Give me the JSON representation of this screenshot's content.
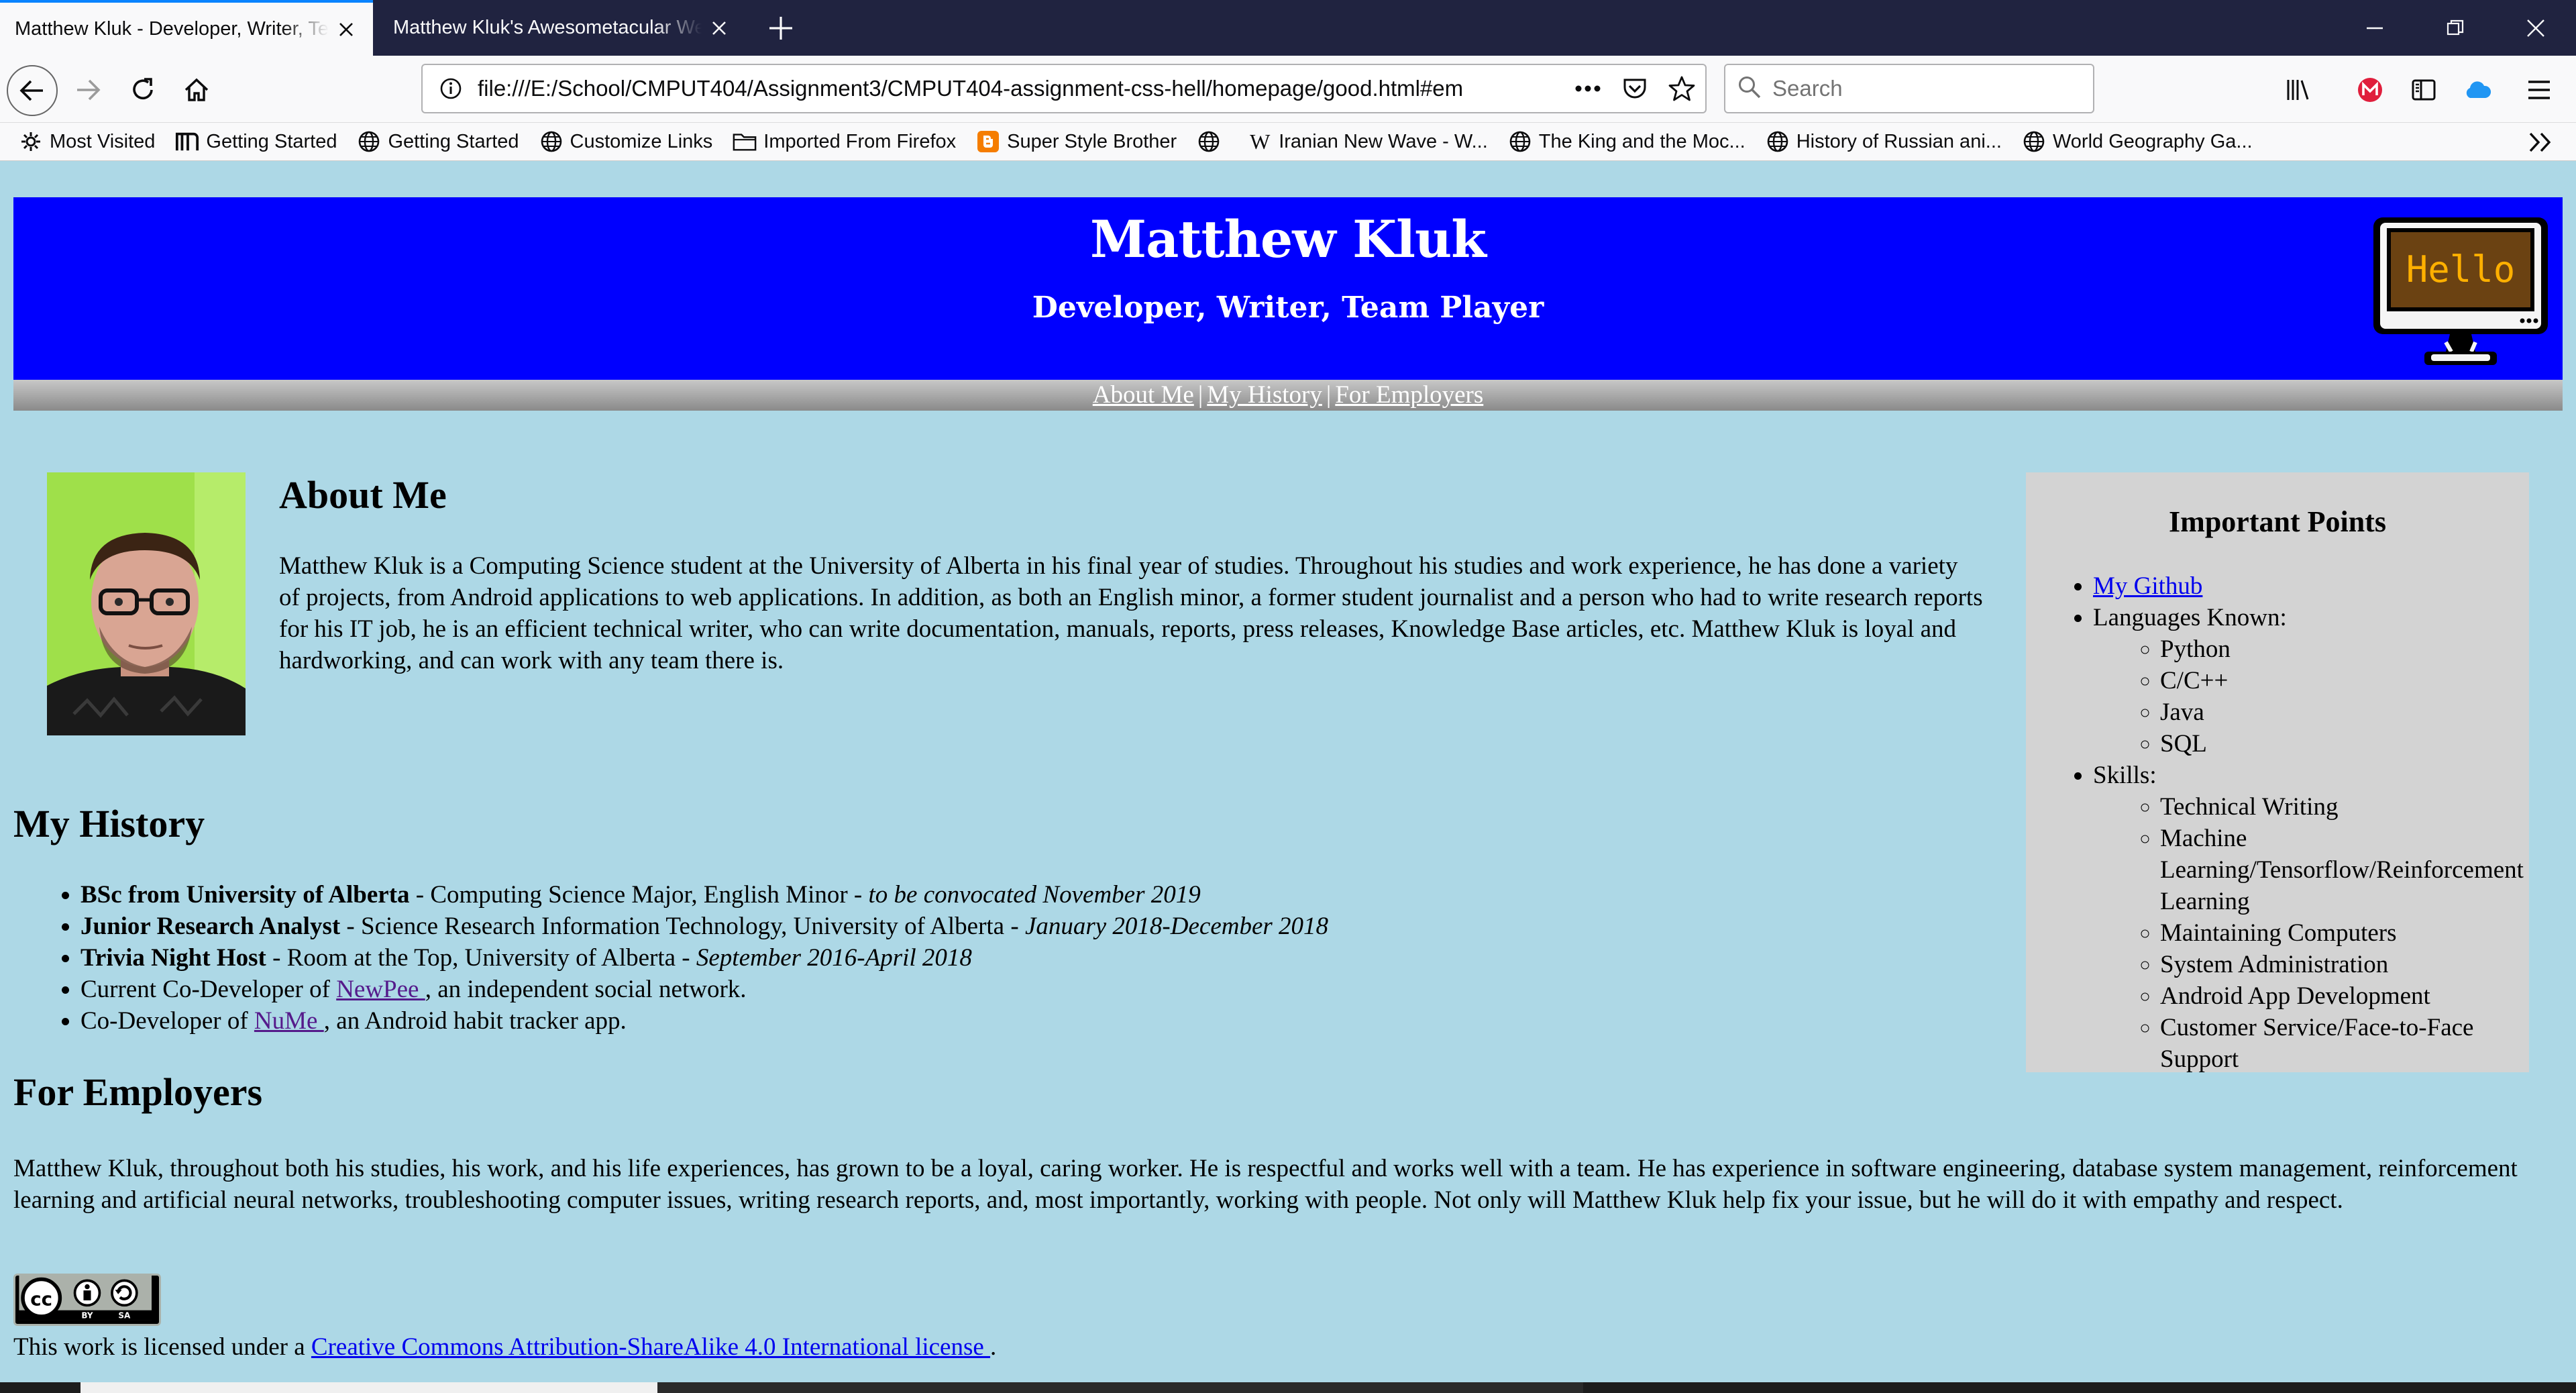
{
  "browser": {
    "tabs": [
      {
        "title": "Matthew Kluk - Developer, Writer, Team Player",
        "active": true
      },
      {
        "title": "Matthew Kluk's Awesometacular Website",
        "active": false
      }
    ],
    "url": "file:///E:/School/CMPUT404/Assignment3/CMPUT404-assignment-css-hell/homepage/good.html#em",
    "search_placeholder": "Search",
    "bookmarks": [
      {
        "label": "Most Visited",
        "icon": "gear-icon"
      },
      {
        "label": "Getting Started",
        "icon": "m-logo-icon"
      },
      {
        "label": "Getting Started",
        "icon": "globe-icon"
      },
      {
        "label": "Customize Links",
        "icon": "globe-icon"
      },
      {
        "label": "Imported From Firefox",
        "icon": "folder-icon"
      },
      {
        "label": "Super Style Brother",
        "icon": "blogger-icon"
      },
      {
        "label": "",
        "icon": "globe-icon"
      },
      {
        "label": "Iranian New Wave - W...",
        "icon": "wikipedia-icon"
      },
      {
        "label": "The King and the Moc...",
        "icon": "globe-icon"
      },
      {
        "label": "History of Russian ani...",
        "icon": "globe-icon"
      },
      {
        "label": "World Geography Ga...",
        "icon": "globe-icon"
      }
    ]
  },
  "header": {
    "title": "Matthew Kluk",
    "subtitle": "Developer, Writer, Team Player",
    "monitor_text": "Hello"
  },
  "nav": {
    "about": "About Me",
    "history": "My History",
    "employers": "For Employers",
    "separator": "|"
  },
  "about": {
    "title": "About Me",
    "text": "Matthew Kluk is a Computing Science student at the University of Alberta in his final year of studies. Throughout his studies and work experience, he has done a variety of projects, from Android applications to web applications. In addition, as both an English minor, a former student journalist and a person who had to write research reports for his IT job, he is an efficient technical writer, who can write documentation, manuals, reports, press releases, Knowledge Base articles, etc. Matthew Kluk is loyal and hardworking, and can work with any team there is."
  },
  "history": {
    "title": "My History",
    "items": [
      {
        "bold": "BSc from University of Alberta",
        "text": " - Computing Science Major, English Minor - ",
        "italic": "to be convocated November 2019"
      },
      {
        "bold": "Junior Research Analyst",
        "text": " - Science Research Information Technology, University of Alberta - ",
        "italic": "January 2018-December 2018"
      },
      {
        "bold": "Trivia Night Host",
        "text": " - Room at the Top, University of Alberta - ",
        "italic": "September 2016-April 2018"
      }
    ],
    "newpee": {
      "prefix": "Current Co-Developer of ",
      "link": "NewPee ",
      "suffix": ", an independent social network."
    },
    "nume": {
      "prefix": "Co-Developer of ",
      "link": "NuMe ",
      "suffix": ", an Android habit tracker app."
    }
  },
  "employers": {
    "title": "For Employers",
    "text": "Matthew Kluk, throughout both his studies, his work, and his life experiences, has grown to be a loyal, caring worker. He is respectful and works well with a team. He has experience in software engineering, database system management, reinforcement learning and artificial neural networks, troubleshooting computer issues, writing research reports, and, most importantly, working with people. Not only will Matthew Kluk help fix your issue, but he will do it with empathy and respect."
  },
  "license": {
    "badge_by": "BY",
    "badge_sa": "SA",
    "prefix": "This work is licensed under a ",
    "link": "Creative Commons Attribution-ShareAlike 4.0 International license ",
    "suffix": "."
  },
  "sidebar": {
    "title": "Important Points",
    "github": "My Github",
    "languages_label": "Languages Known:",
    "languages": [
      "Python",
      "C/C++",
      "Java",
      "SQL"
    ],
    "skills_label": "Skills:",
    "skills": [
      "Technical Writing",
      "Machine Learning/Tensorflow/Reinforcement Learning",
      "Maintaining Computers",
      "System Administration",
      "Android App Development",
      "Customer Service/Face-to-Face Support"
    ]
  },
  "colors": {
    "page_bg": "#add8e6",
    "header_bg": "#0000ff",
    "sidebar_bg": "#d3d3d3",
    "tab_accent": "#0a84ff",
    "tabbar_bg": "#202340"
  }
}
